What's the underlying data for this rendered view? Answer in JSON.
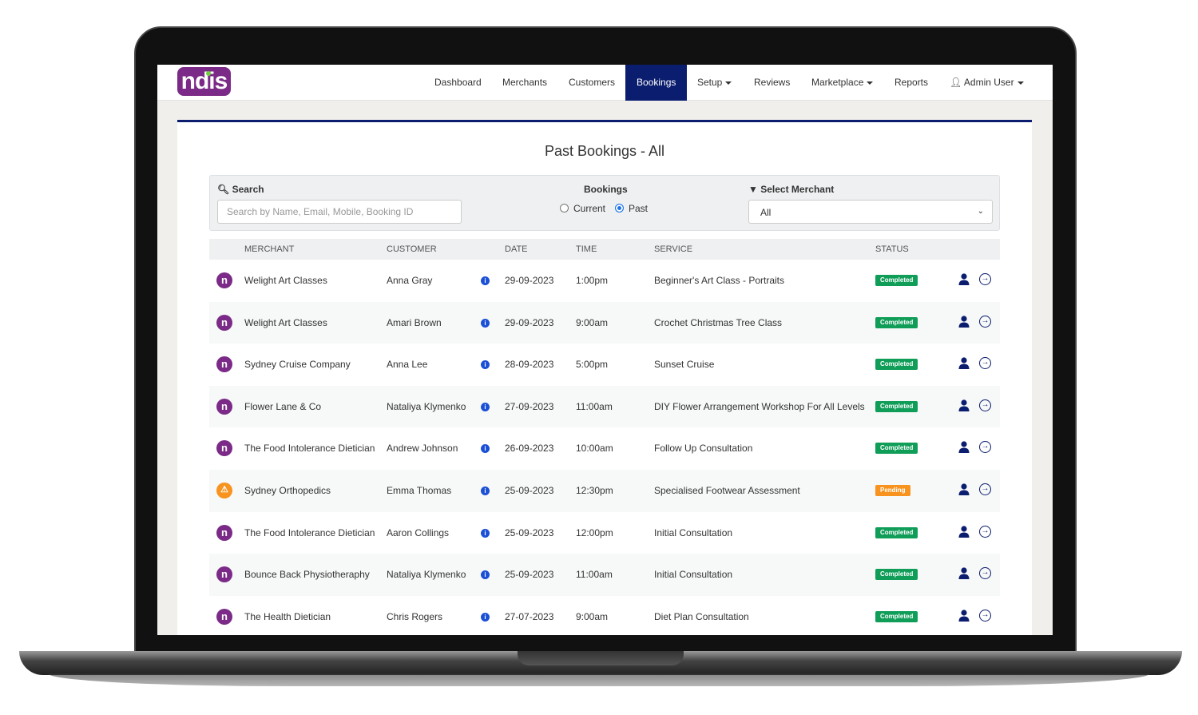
{
  "nav": {
    "logo": "ndis",
    "items": [
      {
        "label": "Dashboard"
      },
      {
        "label": "Merchants"
      },
      {
        "label": "Customers"
      },
      {
        "label": "Bookings",
        "active": true
      },
      {
        "label": "Setup",
        "dropdown": true
      },
      {
        "label": "Reviews"
      },
      {
        "label": "Marketplace",
        "dropdown": true
      },
      {
        "label": "Reports"
      },
      {
        "label": "Admin User",
        "dropdown": true,
        "icon": "user-icon"
      }
    ]
  },
  "page": {
    "title": "Past Bookings - All"
  },
  "filters": {
    "search_label": "Search",
    "search_placeholder": "Search by Name, Email, Mobile, Booking ID",
    "bookings_label": "Bookings",
    "radio_current": "Current",
    "radio_past": "Past",
    "selected": "Past",
    "merchant_label": "Select Merchant",
    "merchant_value": "All"
  },
  "table": {
    "headers": [
      "MERCHANT",
      "CUSTOMER",
      "DATE",
      "TIME",
      "SERVICE",
      "STATUS"
    ],
    "rows": [
      {
        "merchant": "Welight Art Classes",
        "customer": "Anna Gray",
        "date": "29-09-2023",
        "time": "1:00pm",
        "service": "Beginner's Art Class - Portraits",
        "status": "Completed"
      },
      {
        "merchant": "Welight Art Classes",
        "customer": "Amari Brown",
        "date": "29-09-2023",
        "time": "9:00am",
        "service": "Crochet Christmas Tree Class",
        "status": "Completed"
      },
      {
        "merchant": "Sydney Cruise Company",
        "customer": "Anna Lee",
        "date": "28-09-2023",
        "time": "5:00pm",
        "service": "Sunset Cruise",
        "status": "Completed"
      },
      {
        "merchant": "Flower Lane & Co",
        "customer": "Nataliya Klymenko",
        "date": "27-09-2023",
        "time": "11:00am",
        "service": "DIY Flower Arrangement Workshop For All Levels",
        "status": "Completed"
      },
      {
        "merchant": "The Food Intolerance Dietician",
        "customer": "Andrew Johnson",
        "date": "26-09-2023",
        "time": "10:00am",
        "service": "Follow Up Consultation",
        "status": "Completed"
      },
      {
        "merchant": "Sydney Orthopedics",
        "customer": "Emma Thomas",
        "date": "25-09-2023",
        "time": "12:30pm",
        "service": "Specialised Footwear Assessment",
        "status": "Pending"
      },
      {
        "merchant": "The Food Intolerance Dietician",
        "customer": "Aaron Collings",
        "date": "25-09-2023",
        "time": "12:00pm",
        "service": "Initial Consultation",
        "status": "Completed"
      },
      {
        "merchant": "Bounce Back Physiotheraphy",
        "customer": "Nataliya Klymenko",
        "date": "25-09-2023",
        "time": "11:00am",
        "service": "Initial Consultation",
        "status": "Completed"
      },
      {
        "merchant": "The Health Dietician",
        "customer": "Chris Rogers",
        "date": "27-07-2023",
        "time": "9:00am",
        "service": "Diet Plan Consultation",
        "status": "Completed"
      }
    ]
  },
  "colors": {
    "brand": "#7b2a87",
    "nav_active": "#0b1d6e",
    "completed": "#0f9d58",
    "pending": "#f7931e"
  }
}
